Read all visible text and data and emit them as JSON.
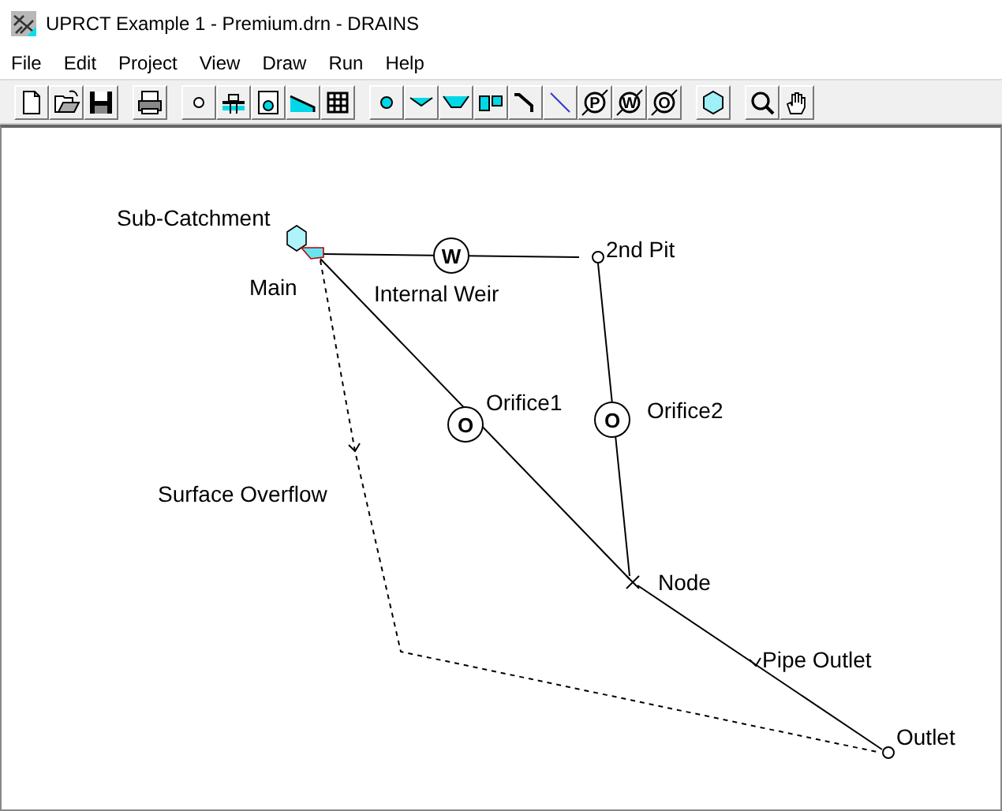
{
  "window": {
    "title": "UPRCT Example 1 - Premium.drn - DRAINS"
  },
  "menu": [
    "File",
    "Edit",
    "Project",
    "View",
    "Draw",
    "Run",
    "Help"
  ],
  "toolbar": [
    [
      {
        "kind": "new"
      },
      {
        "kind": "open"
      },
      {
        "kind": "save"
      }
    ],
    [
      {
        "kind": "print"
      }
    ],
    [
      {
        "kind": "pit"
      },
      {
        "kind": "grate"
      },
      {
        "kind": "sag"
      },
      {
        "kind": "wedge"
      },
      {
        "kind": "grid"
      }
    ],
    [
      {
        "kind": "pit-cyan"
      },
      {
        "kind": "channel"
      },
      {
        "kind": "channel-trap"
      },
      {
        "kind": "twin"
      },
      {
        "kind": "pipe"
      },
      {
        "kind": "line"
      },
      {
        "kind": "letter",
        "glyph": "P"
      },
      {
        "kind": "letter",
        "glyph": "W"
      },
      {
        "kind": "letter",
        "glyph": "O"
      }
    ],
    [
      {
        "kind": "catchment"
      }
    ],
    [
      {
        "kind": "zoom"
      },
      {
        "kind": "hand"
      }
    ]
  ],
  "diagram": {
    "nodes": [
      {
        "kind": "catchment",
        "label": "Sub-Catchment"
      },
      {
        "kind": "pit",
        "label": "Main"
      },
      {
        "kind": "pit",
        "label": "2nd Pit"
      },
      {
        "kind": "junction",
        "label": "Node"
      },
      {
        "kind": "outlet",
        "label": "Outlet"
      }
    ],
    "links": [
      {
        "kind": "weir",
        "label": "Internal Weir",
        "symbol": "W"
      },
      {
        "kind": "orifice",
        "label": "Orifice1",
        "symbol": "O"
      },
      {
        "kind": "orifice",
        "label": "Orifice2",
        "symbol": "O"
      },
      {
        "kind": "pipe",
        "label": "Pipe Outlet"
      },
      {
        "kind": "overflow",
        "label": "Surface Overflow"
      }
    ]
  }
}
